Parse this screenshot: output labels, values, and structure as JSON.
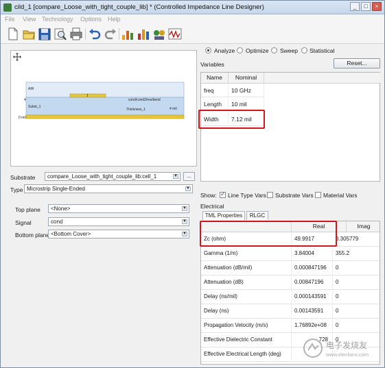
{
  "window": {
    "title": "cild_1 [compare_Loose_with_tight_couple_lib] * (Controlled Impedance Line Designer)",
    "buttons": [
      "_",
      "□",
      "×"
    ]
  },
  "menu": [
    "File",
    "View",
    "Technology",
    "Options",
    "Help"
  ],
  "toolbar": [
    "new-icon",
    "open-icon",
    "save-icon",
    "zoom-icon",
    "print-icon",
    "undo-icon",
    "redo-icon",
    "bar-chart-icon",
    "bar-chart-color-icon",
    "component-icon",
    "waveform-icon"
  ],
  "preview": {
    "labels": {
      "air": "AIR",
      "trace": "1",
      "conductor": "cond/cond2/res/bend",
      "left_value": "4",
      "subst": "Subst_1",
      "thickness": "Thickness_1",
      "thickness_value": "4 mil",
      "zero": "0 mil"
    }
  },
  "substrate": {
    "label": "Substrate",
    "value": "compare_Loose_with_tight_couple_lib:cell_1",
    "browse": "..."
  },
  "type": {
    "label": "Type",
    "value": "Microstrip Single-Ended"
  },
  "planes": [
    {
      "label": "Top plane",
      "value": "<None>"
    },
    {
      "label": "Signal",
      "value": "cond"
    },
    {
      "label": "Bottom plane",
      "value": "<Bottom Cover>"
    }
  ],
  "modes": [
    {
      "label": "Analyze",
      "checked": true
    },
    {
      "label": "Optimize",
      "checked": false
    },
    {
      "label": "Sweep",
      "checked": false
    },
    {
      "label": "Statistical",
      "checked": false
    }
  ],
  "variables": {
    "label": "Variables",
    "reset": "Reset...",
    "headers": [
      "Name",
      "Nominal"
    ],
    "rows": [
      {
        "name": "freq",
        "value": "10 GHz"
      },
      {
        "name": "Length",
        "value": "10 mil"
      },
      {
        "name": "Width",
        "value": "7.12 mil"
      }
    ]
  },
  "show": {
    "label": "Show:",
    "options": [
      {
        "label": "Line Type Vars",
        "checked": true
      },
      {
        "label": "Substrate Vars",
        "checked": false
      },
      {
        "label": "Material Vars",
        "checked": false
      }
    ]
  },
  "electrical": {
    "label": "Electrical",
    "tabs": [
      "TML Properties",
      "RLGC"
    ],
    "headers": [
      "",
      "Real",
      "Imag"
    ],
    "rows": [
      {
        "name": "Zc (ohm)",
        "real": "49.9917",
        "imag": "0.305779"
      },
      {
        "name": "Gamma (1/m)",
        "real": "3.84004",
        "imag": "355.2"
      },
      {
        "name": "Attenuation (dB/mil)",
        "real": "0.000847196",
        "imag": "0"
      },
      {
        "name": "Attenuation (dB)",
        "real": "0.00847196",
        "imag": "0"
      },
      {
        "name": "Delay (ns/mil)",
        "real": "0.000143591",
        "imag": "0"
      },
      {
        "name": "Delay (ns)",
        "real": "0.00143591",
        "imag": "0"
      },
      {
        "name": "Propagation Velocity (m/s)",
        "real": "1.76892e+08",
        "imag": "0"
      },
      {
        "name": "Effective Dielectric Constant",
        "real": "728",
        "imag": "0"
      },
      {
        "name": "Effective Electrical Length (deg)",
        "real": "",
        "imag": ""
      }
    ]
  },
  "watermark": {
    "line1": "电子发烧友",
    "line2": "www.elecfans.com"
  }
}
